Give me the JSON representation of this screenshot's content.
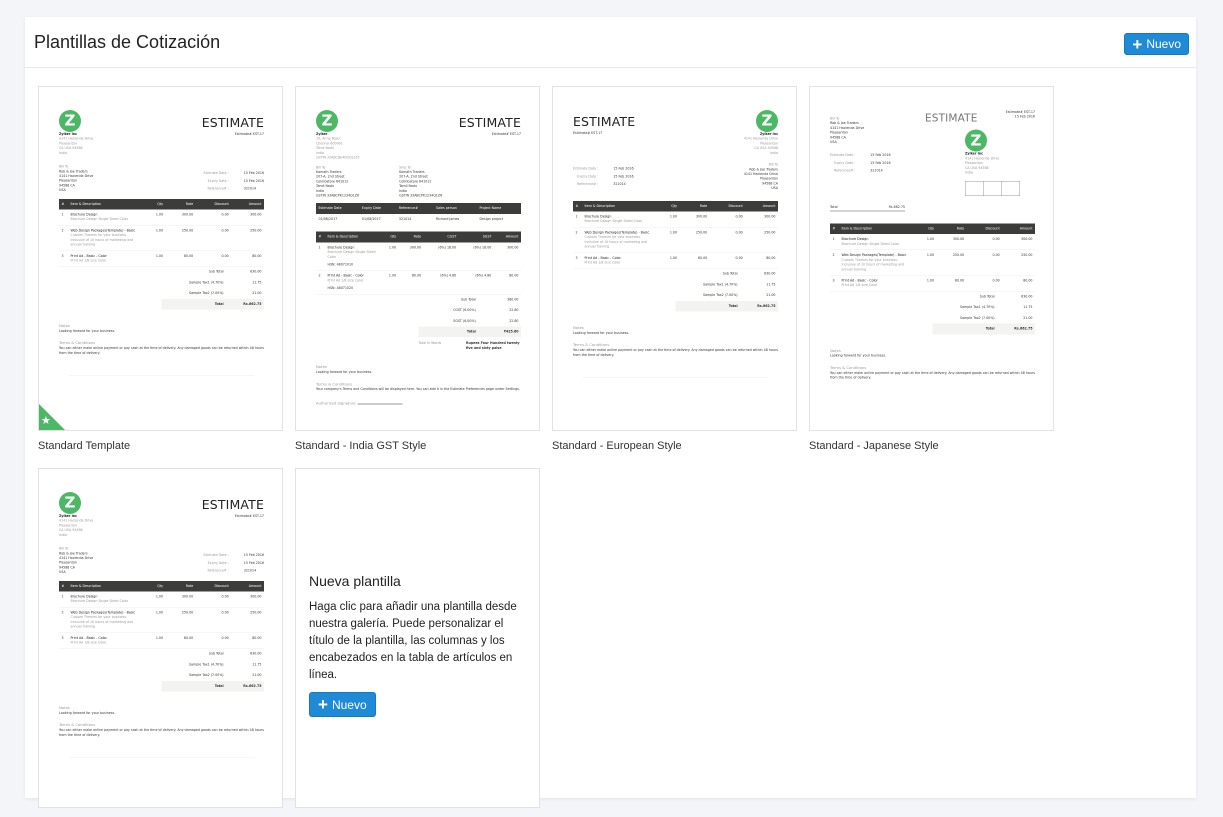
{
  "header": {
    "title": "Plantillas de Cotización",
    "new_label": "Nuevo"
  },
  "colors": {
    "accent": "#1f8ad6",
    "logo_green": "#4cb866",
    "table_header": "#3c3c3a"
  },
  "templates": [
    {
      "name": "Standard Template",
      "variant": "standard",
      "default": true
    },
    {
      "name": "Standard - India GST Style",
      "variant": "gst"
    },
    {
      "name": "Standard - European Style",
      "variant": "european"
    },
    {
      "name": "Standard - Japanese Style",
      "variant": "japanese"
    },
    {
      "name": "",
      "variant": "standard"
    }
  ],
  "new_template": {
    "title": "Nueva plantilla",
    "text": "Haga clic para añadir una plantilla desde nuestra galería. Puede personalizar el título de la plantilla, las columnas y los encabezados en la tabla de artículos en línea.",
    "button": "Nuevo"
  },
  "sample": {
    "logo_letter": "Z",
    "title": "ESTIMATE",
    "number": "Estimate# EST-17",
    "date": "15 Feb 2016",
    "company": {
      "name": "Zylker Inc",
      "lines": [
        "4141 Hacienda Drive",
        "Pleasanton",
        "CA USA 94588",
        "India"
      ]
    },
    "bill_to": {
      "label": "Bill To",
      "lines": [
        "Rob & Joe Traders",
        "4141 Hacienda Drive",
        "Pleasanton",
        "94588 CA",
        "USA"
      ]
    },
    "meta": [
      [
        "Estimate Date :",
        "15 Feb 2016"
      ],
      [
        "Expiry Date :",
        "15 Feb 2016"
      ],
      [
        "Reference# :",
        "321014"
      ]
    ],
    "columns": [
      "#",
      "Item & Description",
      "Qty",
      "Rate",
      "Discount",
      "Amount"
    ],
    "items": [
      [
        "1",
        "Brochure Design",
        "Brochure Design Single Sided Color",
        "1.00",
        "300.00",
        "0.00",
        "300.00"
      ],
      [
        "2",
        "Web Design Packages(Template) - Basic",
        "Custom Themes for your business. Inclusive of 10 hours of marketing and annual training",
        "1.00",
        "250.00",
        "0.00",
        "250.00"
      ],
      [
        "3",
        "Print Ad - Basic - Color",
        "Print Ad 1/8 size Color",
        "1.00",
        "80.00",
        "0.00",
        "80.00"
      ]
    ],
    "totals": [
      [
        "Sub Total",
        "630.00"
      ],
      [
        "Sample Tax1 (4.70%)",
        "11.75"
      ],
      [
        "Sample Tax2 (7.00%)",
        "21.00"
      ]
    ],
    "total": [
      "Total",
      "Rs.662.75"
    ],
    "notes_label": "Notes",
    "notes": "Looking forward for your business.",
    "terms_label": "Terms & Conditions",
    "terms": "You can either make online payment or pay cash at the time of delivery. Any damaged goods can be returned within 48 hours from the time of delivery."
  },
  "gst": {
    "company": {
      "name": "Zylker",
      "lines": [
        "10, Anna Road",
        "Chennai 600001",
        "Tamil Nadu",
        "India",
        "GSTIN 33ABCDE4002Q1Z5"
      ]
    },
    "bill_to": {
      "label": "Bill To",
      "lines": [
        "Kamath Traders",
        "207-A, 2nd Street",
        "Coimbatore 641012",
        "Tamil Nadu",
        "India",
        "GSTIN 33ABCPK1234Q1Z6"
      ]
    },
    "ship_to": {
      "label": "Ship To",
      "lines": [
        "Kamath Traders",
        "207-A, 2nd Street",
        "Coimbatore 641012",
        "Tamil Nadu",
        "India",
        "GSTIN 33ABCPK1234Q1Z6"
      ]
    },
    "meta_headers": [
      "Estimate Date",
      "Expiry Date",
      "Reference#",
      "Sales person",
      "Project Name"
    ],
    "meta_values": [
      "01/08/2017",
      "01/08/2017",
      "321014",
      "Richard James",
      "Design project"
    ],
    "columns": [
      "#",
      "Item & Description",
      "Qty",
      "Rate",
      "CGST",
      "SGST",
      "Amount"
    ],
    "items": [
      [
        "1",
        "Brochure Design",
        "Brochure Design Single Sided Color",
        "HSN: 48071010",
        "1.00",
        "300.00",
        "(6%) 18.00",
        "(6%) 18.00",
        "300.00"
      ],
      [
        "2",
        "Print Ad - Basic - Color",
        "Print Ad 1/8 size Color",
        "HSN: 48071020",
        "1.00",
        "80.00",
        "(6%) 4.80",
        "(6%) 4.80",
        "80.00"
      ]
    ],
    "totals": [
      [
        "Sub Total",
        "380.00"
      ],
      [
        "CGST (6.00%)",
        "22.80"
      ],
      [
        "SGST (6.00%)",
        "22.80"
      ]
    ],
    "total": [
      "Total",
      "₹425.60"
    ],
    "words_label": "Total In Words",
    "words": "Rupees Four Hundred twenty five and sixty paise",
    "terms": "Your company's Terms and Conditions will be displayed here. You can add it in the Estimate Preferences page under Settings.",
    "signature": "Authorized Signature"
  }
}
